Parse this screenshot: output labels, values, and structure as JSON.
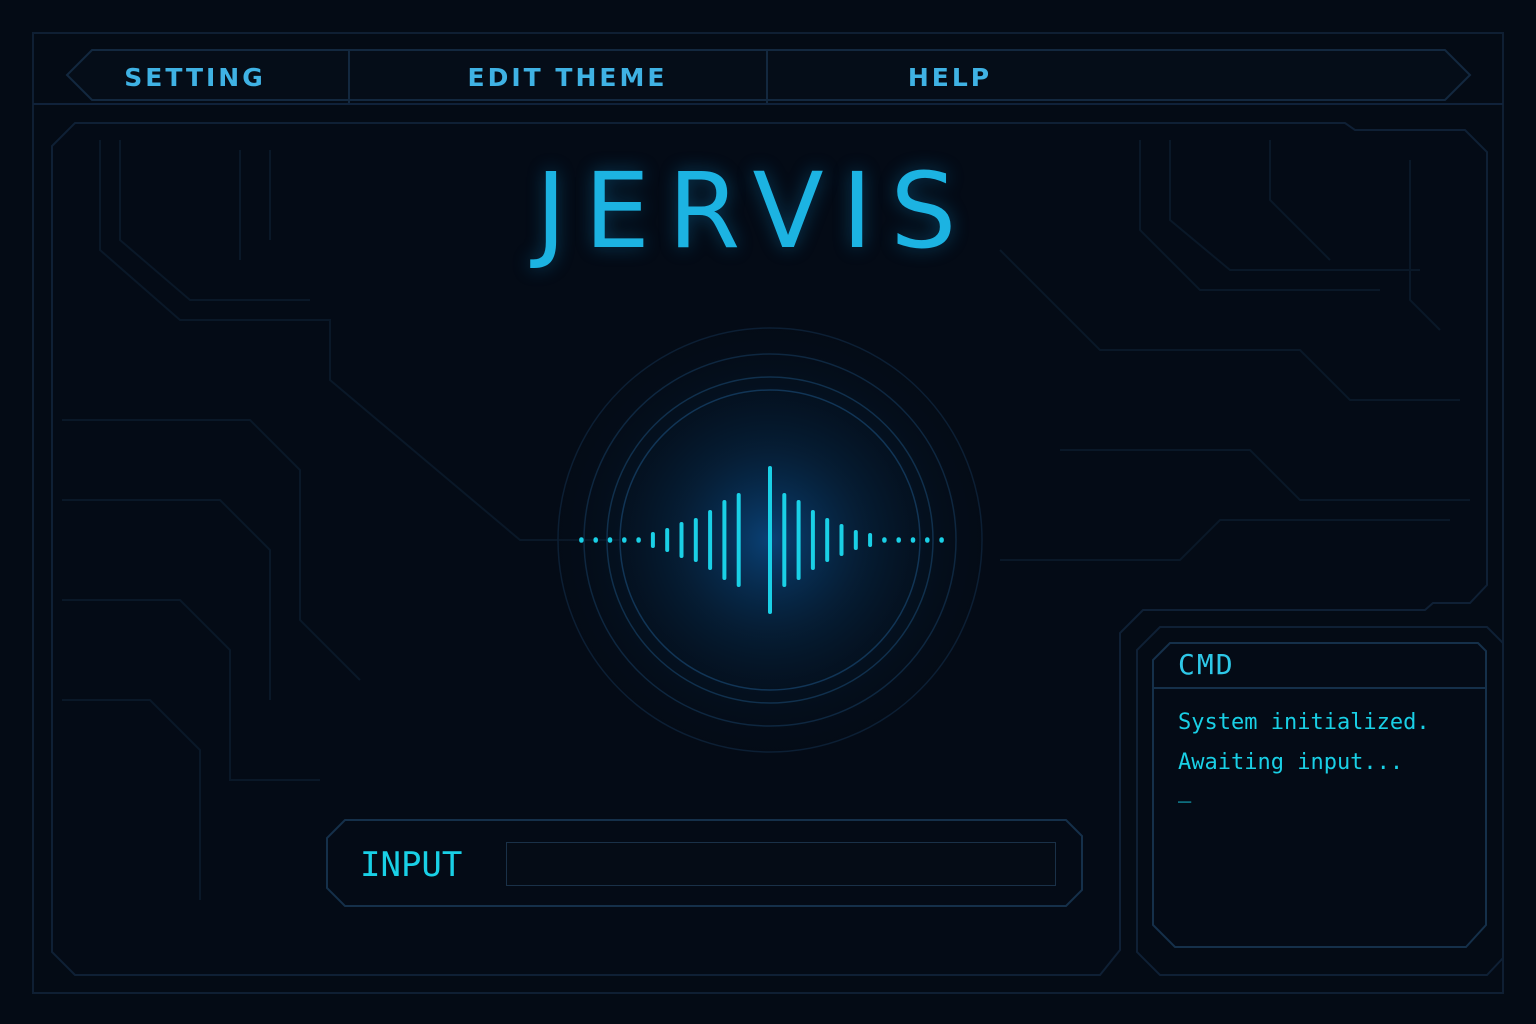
{
  "app": {
    "title": "JERVIS",
    "accent_color": "#19cbe6",
    "background_color": "#040b15"
  },
  "menu": {
    "items": [
      {
        "label": "SETTING"
      },
      {
        "label": "EDIT THEME"
      },
      {
        "label": "HELP"
      }
    ]
  },
  "voice": {
    "icon": "sound-wave-icon"
  },
  "input": {
    "label": "INPUT",
    "value": "",
    "placeholder": ""
  },
  "cmd": {
    "title": "CMD",
    "lines": [
      "System initialized.",
      "Awaiting input..."
    ],
    "cursor": "_"
  }
}
